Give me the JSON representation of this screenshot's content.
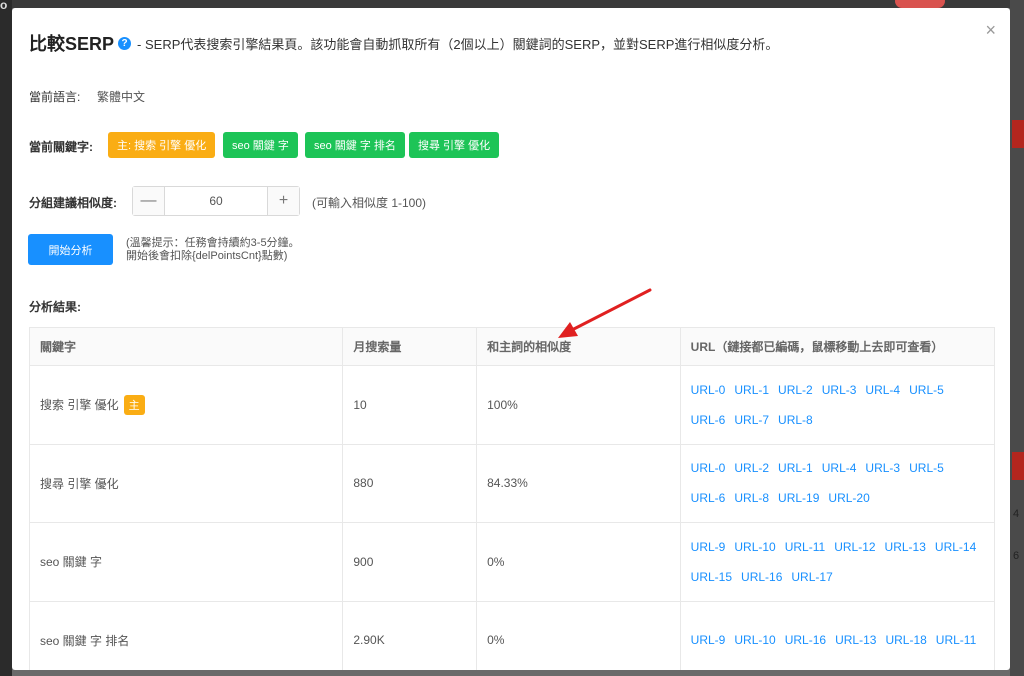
{
  "background": {
    "top_glyph": "o",
    "right_numbers": [
      "4",
      "6"
    ]
  },
  "modal": {
    "close_glyph": "×",
    "title": "比較SERP",
    "help_glyph": "?",
    "description": "- SERP代表搜索引擎結果頁。該功能會自動抓取所有（2個以上）關鍵詞的SERP，並對SERP進行相似度分析。",
    "language_label": "當前語言:",
    "language_value": "繁體中文",
    "keywords_label": "當前關鍵字:",
    "keywords": [
      {
        "label": "主: 搜索 引擎 優化",
        "color": "#faad14"
      },
      {
        "label": "seo 關鍵 字",
        "color": "#1dc457"
      },
      {
        "label": "seo 關鍵 字 排名",
        "color": "#1dc457"
      },
      {
        "label": "搜尋 引擎 優化",
        "color": "#1dc457"
      }
    ],
    "similarity_label": "分組建議相似度:",
    "similarity_value": "60",
    "minus_glyph": "—",
    "plus_glyph": "+",
    "similarity_hint": "(可輸入相似度 1-100)",
    "start_button": "開始分析",
    "tip_line1": "(溫馨提示：任務會持續約3-5分鐘。",
    "tip_line2": "開始後會扣除{delPointsCnt}點數)",
    "results_label": "分析結果:",
    "table": {
      "headers": [
        "關鍵字",
        "月搜索量",
        "和主詞的相似度",
        "URL（鏈接都已編碼，鼠標移動上去即可查看）"
      ],
      "main_tag": "主",
      "rows": [
        {
          "keyword": "搜索 引擎 優化",
          "is_main": true,
          "volume": "10",
          "similarity": "100%",
          "urls": [
            "URL-0",
            "URL-1",
            "URL-2",
            "URL-3",
            "URL-4",
            "URL-5",
            "URL-6",
            "URL-7",
            "URL-8"
          ]
        },
        {
          "keyword": "搜尋 引擎 優化",
          "is_main": false,
          "volume": "880",
          "similarity": "84.33%",
          "urls": [
            "URL-0",
            "URL-2",
            "URL-1",
            "URL-4",
            "URL-3",
            "URL-5",
            "URL-6",
            "URL-8",
            "URL-19",
            "URL-20"
          ]
        },
        {
          "keyword": "seo 關鍵 字",
          "is_main": false,
          "volume": "900",
          "similarity": "0%",
          "urls": [
            "URL-9",
            "URL-10",
            "URL-11",
            "URL-12",
            "URL-13",
            "URL-14",
            "URL-15",
            "URL-16",
            "URL-17"
          ]
        },
        {
          "keyword": "seo 關鍵 字 排名",
          "is_main": false,
          "volume": "2.90K",
          "similarity": "0%",
          "urls": [
            "URL-9",
            "URL-10",
            "URL-16",
            "URL-13",
            "URL-18",
            "URL-11"
          ]
        }
      ]
    }
  },
  "annotation": {
    "arrow_color": "#e02020"
  }
}
